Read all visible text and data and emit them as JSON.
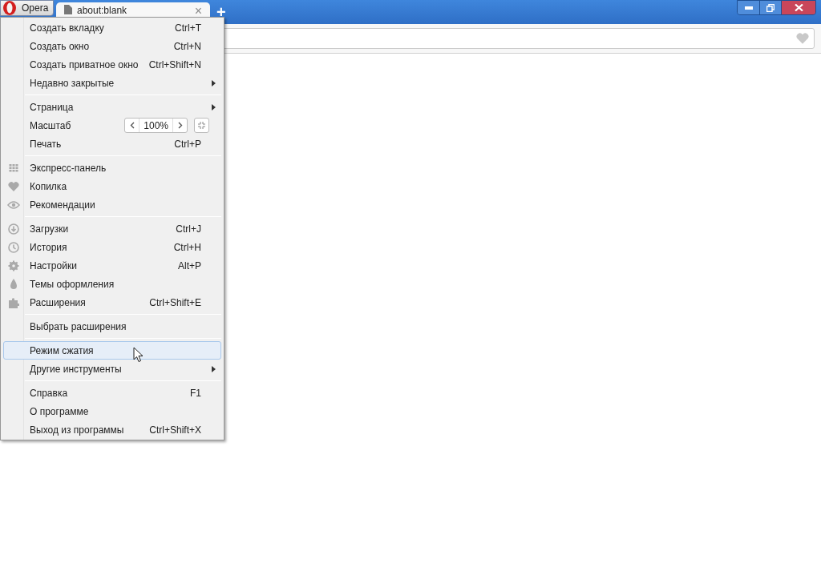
{
  "app_button": {
    "label": "Opera"
  },
  "tab": {
    "title": "about:blank",
    "close": "×"
  },
  "new_tab": "+",
  "menu": {
    "groups": [
      {
        "items": [
          {
            "kind": "item",
            "label": "Создать вкладку",
            "shortcut": "Ctrl+T",
            "selected": false
          },
          {
            "kind": "item",
            "label": "Создать окно",
            "shortcut": "Ctrl+N",
            "selected": false
          },
          {
            "kind": "item",
            "label": "Создать приватное окно",
            "shortcut": "Ctrl+Shift+N",
            "selected": false
          },
          {
            "kind": "submenu",
            "label": "Недавно закрытые",
            "selected": false
          }
        ]
      },
      {
        "items": [
          {
            "kind": "submenu",
            "label": "Страница",
            "selected": false
          },
          {
            "kind": "zoom",
            "label": "Масштаб",
            "value": "100%",
            "selected": false
          },
          {
            "kind": "item",
            "label": "Печать",
            "shortcut": "Ctrl+P",
            "selected": false
          }
        ]
      },
      {
        "items": [
          {
            "kind": "item",
            "label": "Экспресс-панель",
            "selected": false
          },
          {
            "kind": "item",
            "label": "Копилка",
            "selected": false
          },
          {
            "kind": "item",
            "label": "Рекомендации",
            "selected": false
          }
        ]
      },
      {
        "items": [
          {
            "kind": "item",
            "label": "Загрузки",
            "shortcut": "Ctrl+J",
            "selected": false
          },
          {
            "kind": "item",
            "label": "История",
            "shortcut": "Ctrl+H",
            "selected": false
          },
          {
            "kind": "item",
            "label": "Настройки",
            "shortcut": "Alt+P",
            "selected": false
          },
          {
            "kind": "item",
            "label": "Темы оформления",
            "selected": false
          },
          {
            "kind": "item",
            "label": "Расширения",
            "shortcut": "Ctrl+Shift+E",
            "selected": false
          }
        ]
      },
      {
        "items": [
          {
            "kind": "item",
            "label": "Выбрать расширения",
            "selected": false
          }
        ]
      },
      {
        "items": [
          {
            "kind": "item",
            "label": "Режим сжатия",
            "selected": true
          },
          {
            "kind": "submenu",
            "label": "Другие инструменты",
            "selected": false
          }
        ]
      },
      {
        "items": [
          {
            "kind": "item",
            "label": "Справка",
            "shortcut": "F1",
            "selected": false
          },
          {
            "kind": "item",
            "label": "О программе",
            "selected": false
          },
          {
            "kind": "item",
            "label": "Выход из программы",
            "shortcut": "Ctrl+Shift+X",
            "selected": false
          }
        ]
      }
    ]
  }
}
